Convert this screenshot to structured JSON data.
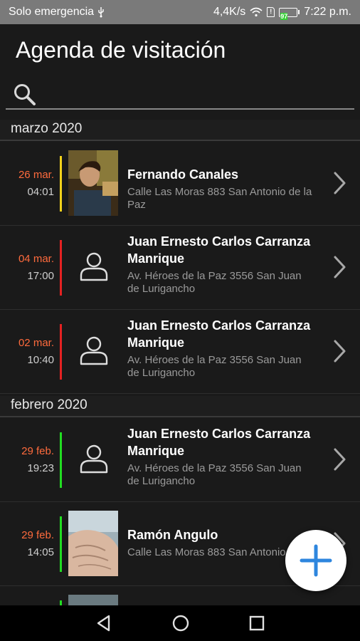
{
  "status_bar": {
    "carrier": "Solo emergencia",
    "net_speed": "4,4K/s",
    "battery": "97",
    "time": "7:22 p.m."
  },
  "header": {
    "title": "Agenda de visitación",
    "search_placeholder": ""
  },
  "sections": [
    {
      "label": "marzo 2020"
    },
    {
      "label": "febrero 2020"
    }
  ],
  "visits": [
    {
      "day": "26 mar.",
      "time": "04:01",
      "name": "Fernando Canales",
      "address": "Calle Las Moras 883 San Antonio de la Paz",
      "status_color": "#f2d21b",
      "has_photo": true
    },
    {
      "day": "04 mar.",
      "time": "17:00",
      "name": "Juan Ernesto Carlos Carranza Manrique",
      "address": "Av. Héroes de la Paz 3556 San Juan de Lurigancho",
      "status_color": "#e52222",
      "has_photo": false
    },
    {
      "day": "02 mar.",
      "time": "10:40",
      "name": "Juan Ernesto Carlos Carranza Manrique",
      "address": "Av. Héroes de la Paz 3556 San Juan de Lurigancho",
      "status_color": "#e52222",
      "has_photo": false
    },
    {
      "day": "29 feb.",
      "time": "19:23",
      "name": "Juan Ernesto Carlos Carranza Manrique",
      "address": "Av. Héroes de la Paz 3556 San Juan de Lurigancho",
      "status_color": "#22dd22",
      "has_photo": false
    },
    {
      "day": "29 feb.",
      "time": "14:05",
      "name": "Ramón Angulo",
      "address": "Calle Las Moras 883 San Antonio",
      "status_color": "#22dd22",
      "has_photo": true
    }
  ],
  "colors": {
    "date_accent": "#ff6b3d",
    "fab_plus": "#2e86de"
  }
}
